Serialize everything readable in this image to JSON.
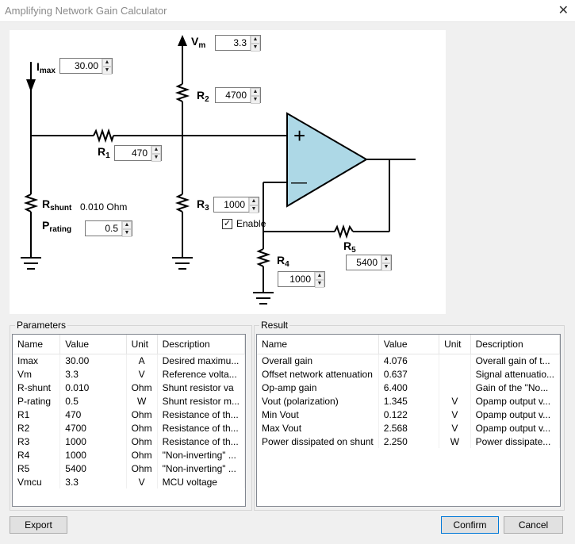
{
  "window": {
    "title": "Amplifying Network Gain Calculator"
  },
  "circuit": {
    "imax_label": "I",
    "imax_sub": "max",
    "imax_value": "30.00",
    "vm_label": "V",
    "vm_sub": "m",
    "vm_value": "3.3",
    "r2_label": "R",
    "r2_sub": "2",
    "r2_value": "4700",
    "r1_label": "R",
    "r1_sub": "1",
    "r1_value": "470",
    "rshunt_label": "R",
    "rshunt_sub": "shunt",
    "rshunt_value": "0.010 Ohm",
    "prating_label": "P",
    "prating_sub": "rating",
    "prating_value": "0.5",
    "r3_label": "R",
    "r3_sub": "3",
    "r3_value": "1000",
    "enable_label": "Enable",
    "enable_checked": true,
    "r4_label": "R",
    "r4_sub": "4",
    "r4_value": "1000",
    "r5_label": "R",
    "r5_sub": "5",
    "r5_value": "5400",
    "opamp_plus": "+",
    "opamp_minus": "—",
    "opamp_color": "#add8e6"
  },
  "parameters": {
    "title": "Parameters",
    "columns": [
      "Name",
      "Value",
      "Unit",
      "Description"
    ],
    "rows": [
      [
        "Imax",
        "30.00",
        "A",
        "Desired maximu..."
      ],
      [
        "Vm",
        "3.3",
        "V",
        "Reference volta..."
      ],
      [
        "R-shunt",
        "0.010",
        "Ohm",
        "Shunt resistor va"
      ],
      [
        "P-rating",
        "0.5",
        "W",
        "Shunt resistor m..."
      ],
      [
        "R1",
        "470",
        "Ohm",
        "Resistance of th..."
      ],
      [
        "R2",
        "4700",
        "Ohm",
        "Resistance of th..."
      ],
      [
        "R3",
        "1000",
        "Ohm",
        "Resistance of th..."
      ],
      [
        "R4",
        "1000",
        "Ohm",
        "\"Non-inverting\" ..."
      ],
      [
        "R5",
        "5400",
        "Ohm",
        "\"Non-inverting\" ..."
      ],
      [
        "Vmcu",
        "3.3",
        "V",
        "MCU voltage"
      ]
    ]
  },
  "result": {
    "title": "Result",
    "columns": [
      "Name",
      "Value",
      "Unit",
      "Description"
    ],
    "rows": [
      [
        "Overall gain",
        "4.076",
        "",
        "Overall gain of t..."
      ],
      [
        "Offset network attenuation",
        "0.637",
        "",
        "Signal attenuatio..."
      ],
      [
        "Op-amp gain",
        "6.400",
        "",
        "Gain of the \"No..."
      ],
      [
        "Vout (polarization)",
        "1.345",
        "V",
        "Opamp output v..."
      ],
      [
        "Min Vout",
        "0.122",
        "V",
        "Opamp output v..."
      ],
      [
        "Max Vout",
        "2.568",
        "V",
        "Opamp output v..."
      ],
      [
        "Power dissipated on shunt",
        "2.250",
        "W",
        "Power dissipate..."
      ]
    ]
  },
  "buttons": {
    "export": "Export",
    "confirm": "Confirm",
    "cancel": "Cancel"
  }
}
